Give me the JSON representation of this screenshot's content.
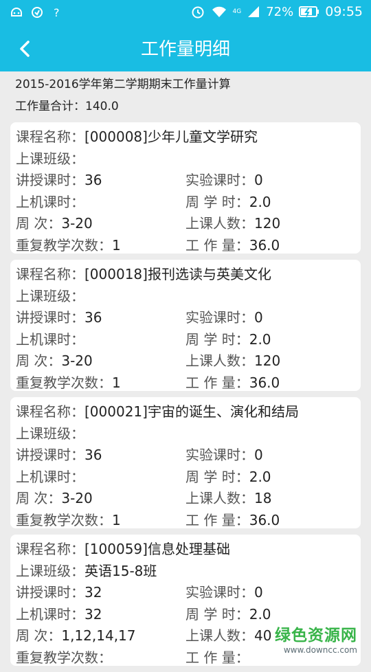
{
  "status": {
    "battery": "72%",
    "time": "09:55",
    "net": "4G"
  },
  "header": {
    "title": "工作量明细",
    "back_icon": "chevron-left-icon"
  },
  "summary": {
    "term": "2015-2016学年第二学期期末工作量计算",
    "total_label": "工作量合计：",
    "total_value": "140.0"
  },
  "labels": {
    "course": "课程名称：",
    "class": "上课班级：",
    "lecture_hours": "讲授课时：",
    "lab_hours": "实验课时：",
    "computer_hours": "上机课时：",
    "weekly_hours": "周 学 时：",
    "weeks": "周 次：",
    "students": "上课人数：",
    "repeat": "重复教学次数：",
    "workload": "工 作 量："
  },
  "courses": [
    {
      "name": "[000008]少年儿童文学研究",
      "class": "",
      "lecture": "36",
      "lab": "0",
      "computer": "",
      "weekly": "2.0",
      "weeks": "3-20",
      "students": "120",
      "repeat": "1",
      "workload": "36.0"
    },
    {
      "name": "[000018]报刊选读与英美文化",
      "class": "",
      "lecture": "36",
      "lab": "0",
      "computer": "",
      "weekly": "2.0",
      "weeks": "3-20",
      "students": "120",
      "repeat": "1",
      "workload": "36.0"
    },
    {
      "name": "[000021]宇宙的诞生、演化和结局",
      "class": "",
      "lecture": "36",
      "lab": "0",
      "computer": "",
      "weekly": "2.0",
      "weeks": "3-20",
      "students": "18",
      "repeat": "1",
      "workload": "36.0"
    },
    {
      "name": "[100059]信息处理基础",
      "class": "英语15-8班",
      "lecture": "32",
      "lab": "0",
      "computer": "32",
      "weekly": "2.0",
      "weeks": "1,12,14,17",
      "students": "40",
      "repeat": "",
      "workload": ""
    }
  ],
  "watermark": {
    "brand": "绿色资源网",
    "url": "www.downcc.com"
  },
  "colors": {
    "primary": "#19bde3",
    "watermark": "#38b449"
  }
}
